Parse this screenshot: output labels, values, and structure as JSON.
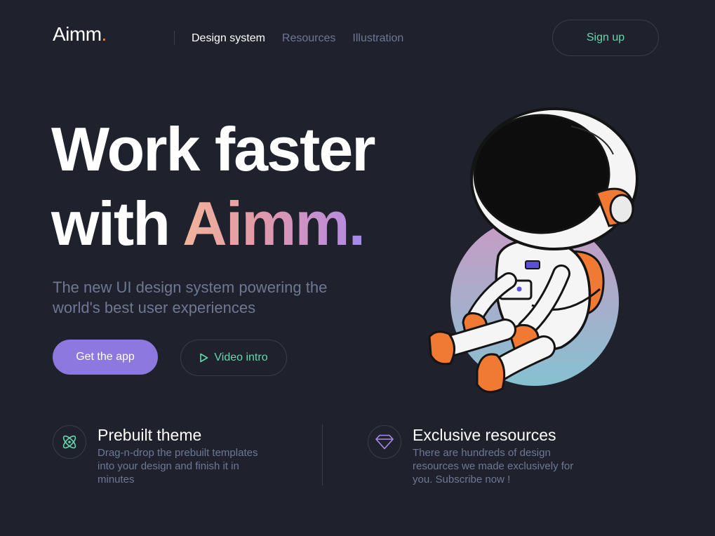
{
  "brand": {
    "name": "Aimm",
    "dot": "."
  },
  "nav": {
    "items": [
      {
        "label": "Design system",
        "active": true
      },
      {
        "label": "Resources",
        "active": false
      },
      {
        "label": "Illustration",
        "active": false
      }
    ],
    "signup_label": "Sign up"
  },
  "hero": {
    "line1": "Work faster",
    "line2_prefix": "with ",
    "line2_brand": "Aimm",
    "line2_dot": ".",
    "subtitle": "The new UI design system powering the world's best user experiences",
    "primary_cta": "Get the app",
    "secondary_cta": "Video intro"
  },
  "features": [
    {
      "icon": "atom-icon",
      "title": "Prebuilt theme",
      "description": "Drag-n-drop the prebuilt templates into your design and finish it in minutes"
    },
    {
      "icon": "diamond-icon",
      "title": "Exclusive resources",
      "description": "There are hundreds of design resources we made exclusively for you. Subscribe now !"
    }
  ],
  "colors": {
    "background": "#1f222c",
    "accent_green": "#65d6ae",
    "accent_purple": "#8d78df",
    "accent_orange": "#f08a3a",
    "muted_text": "#6e7894"
  }
}
